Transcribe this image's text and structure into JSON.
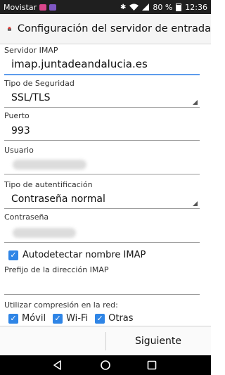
{
  "status_bar": {
    "carrier": "Movistar",
    "battery": "80 %",
    "time": "12:36"
  },
  "action_bar": {
    "title": "Configuración del servidor de entrada",
    "icon": "app-mail-server-icon"
  },
  "form": {
    "imap_server_label": "Servidor IMAP",
    "imap_server_value": "imap.juntadeandalucia.es",
    "security_label": "Tipo de Seguridad",
    "security_value": "SSL/TLS",
    "port_label": "Puerto",
    "port_value": "993",
    "user_label": "Usuario",
    "auth_label": "Tipo de autentificación",
    "auth_value": "Contraseña normal",
    "password_label": "Contraseña",
    "autodetect_label": "Autodetectar nombre IMAP",
    "autodetect_checked": true,
    "prefix_label": "Prefijo de la dirección IMAP",
    "prefix_value": "",
    "compression_label": "Utilizar compresión en la red:",
    "compression_options": [
      {
        "label": "Móvil",
        "checked": true
      },
      {
        "label": "Wi-Fi",
        "checked": true
      },
      {
        "label": "Otras",
        "checked": true
      }
    ]
  },
  "bottom_bar": {
    "next_label": "Siguiente"
  },
  "colors": {
    "accent": "#2f85e6",
    "focus_underline": "#5d9cec"
  }
}
